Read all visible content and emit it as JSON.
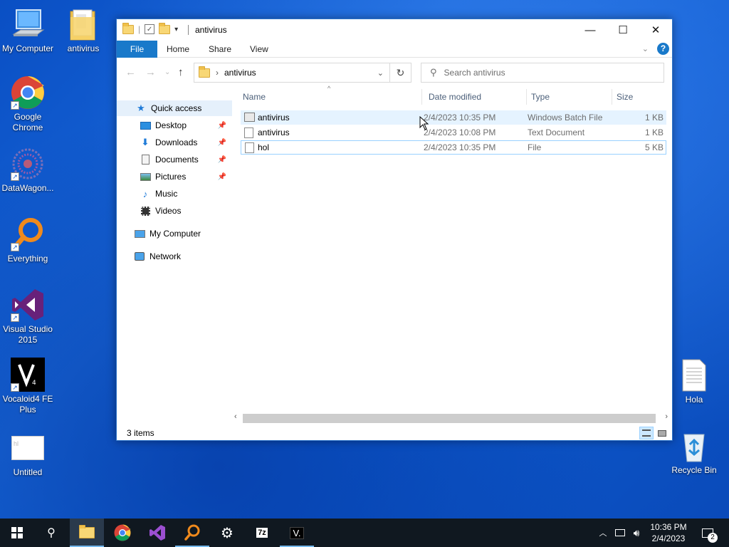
{
  "desktop": {
    "icons": [
      {
        "label": "My Computer",
        "icon": "computer-icon"
      },
      {
        "label": "antivirus",
        "icon": "folder-icon"
      },
      {
        "label": "Google\nChrome",
        "icon": "chrome-icon"
      },
      {
        "label": "DataWagon...",
        "icon": "datawagon-icon"
      },
      {
        "label": "Everything",
        "icon": "everything-search-icon"
      },
      {
        "label": "Visual Studio\n2015",
        "icon": "visual-studio-icon"
      },
      {
        "label": "Vocaloid4 FE\nPlus",
        "icon": "vocaloid-icon"
      },
      {
        "label": "Untitled",
        "icon": "image-file-icon"
      },
      {
        "label": "Hola",
        "icon": "text-file-icon"
      },
      {
        "label": "Recycle Bin",
        "icon": "recycle-bin-icon"
      }
    ],
    "untitled_thumb_text": "hl"
  },
  "window": {
    "title": "antivirus",
    "controls": {
      "minimize": "—",
      "maximize": "☐",
      "close": "✕"
    },
    "ribbon": {
      "file": "File",
      "home": "Home",
      "share": "Share",
      "view": "View",
      "help": "?"
    },
    "address": {
      "path": "antivirus",
      "separator": "›"
    },
    "search": {
      "placeholder": "Search antivirus"
    },
    "sidebar": {
      "quick_access": "Quick access",
      "items": [
        "Desktop",
        "Downloads",
        "Documents",
        "Pictures",
        "Music",
        "Videos"
      ],
      "my_computer": "My Computer",
      "network": "Network"
    },
    "columns": {
      "name": "Name",
      "date": "Date modified",
      "type": "Type",
      "size": "Size"
    },
    "files": [
      {
        "name": "antivirus",
        "date": "2/4/2023 10:35 PM",
        "type": "Windows Batch File",
        "size": "1 KB",
        "icon": "batch-file-icon"
      },
      {
        "name": "antivirus",
        "date": "2/4/2023 10:08 PM",
        "type": "Text Document",
        "size": "1 KB",
        "icon": "text-document-icon"
      },
      {
        "name": "hol",
        "date": "2/4/2023 10:35 PM",
        "type": "File",
        "size": "5 KB",
        "icon": "generic-file-icon"
      }
    ],
    "status": {
      "items": "3 items"
    }
  },
  "taskbar": {
    "clock_time": "10:36 PM",
    "clock_date": "2/4/2023",
    "notification_count": "2",
    "apps": [
      "start",
      "search",
      "file-explorer",
      "chrome",
      "visual-studio",
      "everything",
      "settings",
      "7zip",
      "vocaloid"
    ],
    "sevenzip_label": "7z",
    "vocaloid_label": "V."
  },
  "colors": {
    "accent": "#1979ca",
    "taskbar": "#101820",
    "wallpaper": "#1766d8"
  }
}
